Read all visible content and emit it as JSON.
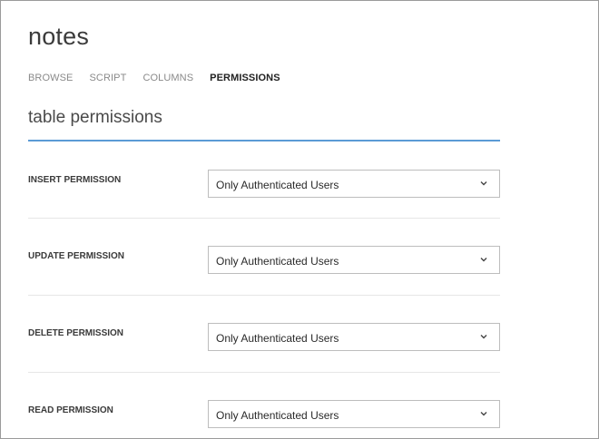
{
  "page": {
    "title": "notes",
    "tabs": [
      {
        "label": "BROWSE",
        "active": false
      },
      {
        "label": "SCRIPT",
        "active": false
      },
      {
        "label": "COLUMNS",
        "active": false
      },
      {
        "label": "PERMISSIONS",
        "active": true
      }
    ],
    "section_title": "table permissions"
  },
  "permissions": [
    {
      "label": "INSERT PERMISSION",
      "value": "Only Authenticated Users"
    },
    {
      "label": "UPDATE PERMISSION",
      "value": "Only Authenticated Users"
    },
    {
      "label": "DELETE PERMISSION",
      "value": "Only Authenticated Users"
    },
    {
      "label": "READ PERMISSION",
      "value": "Only Authenticated Users"
    }
  ],
  "icons": {
    "dropdown": "chevron-down-icon"
  },
  "colors": {
    "accent_rule": "#5b9bd5",
    "active_tab": "#222222",
    "inactive_tab": "#8a8a8a"
  }
}
